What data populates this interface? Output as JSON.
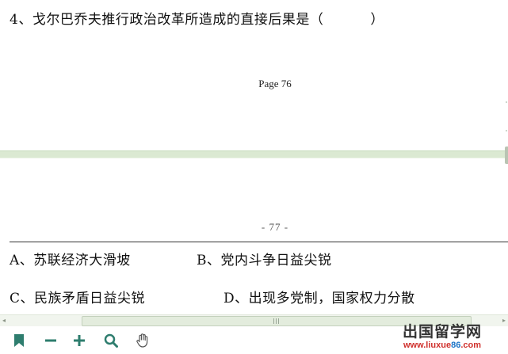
{
  "question": "4、戈尔巴乔夫推行政治改革所造成的直接后果是（          ）",
  "page_label": "Page 76",
  "page_footer": "- 77 -",
  "options": {
    "a": "A、苏联经济大滑坡",
    "b": "B、党内斗争日益尖锐",
    "c": "C、民族矛盾日益尖锐",
    "d": "D、出现多党制，国家权力分散"
  },
  "scrollbar": {
    "left_arrow": "◂",
    "right_arrow": "▸"
  },
  "toolbar": {
    "icons": [
      "bookmark-icon",
      "zoom-out-icon",
      "zoom-in-icon",
      "search-icon",
      "hand-tool-icon"
    ],
    "accent_color": "#2e7d6e"
  },
  "watermark": {
    "cn": "出国留学网",
    "url_prefix": "www.liuxue",
    "url_accent": "86",
    "url_suffix": ".com"
  }
}
